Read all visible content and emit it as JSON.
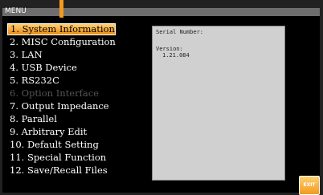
{
  "header": {
    "title": "MENU"
  },
  "menu": {
    "items": [
      {
        "label": "1. System Information",
        "state": "selected"
      },
      {
        "label": "2. MISC Configuration",
        "state": "normal"
      },
      {
        "label": "3. LAN",
        "state": "normal"
      },
      {
        "label": "4. USB Device",
        "state": "normal"
      },
      {
        "label": "5. RS232C",
        "state": "normal"
      },
      {
        "label": "6. Option Interface",
        "state": "disabled"
      },
      {
        "label": "7. Output Impedance",
        "state": "normal"
      },
      {
        "label": "8. Parallel",
        "state": "normal"
      },
      {
        "label": "9. Arbitrary Edit",
        "state": "normal"
      },
      {
        "label": "10. Default Setting",
        "state": "normal"
      },
      {
        "label": "11. Special Function",
        "state": "normal"
      },
      {
        "label": "12. Save/Recall Files",
        "state": "normal"
      }
    ]
  },
  "info": {
    "serial_label": "Serial Number:",
    "version_label": "Version:",
    "version_value": "1.21.084"
  },
  "softkeys": {
    "exit_label": "EXIT"
  },
  "colors": {
    "accent": "#f39a1f",
    "title_bar": "#6e6e6e",
    "panel": "#d0d0d0",
    "disabled_text": "#555555"
  }
}
